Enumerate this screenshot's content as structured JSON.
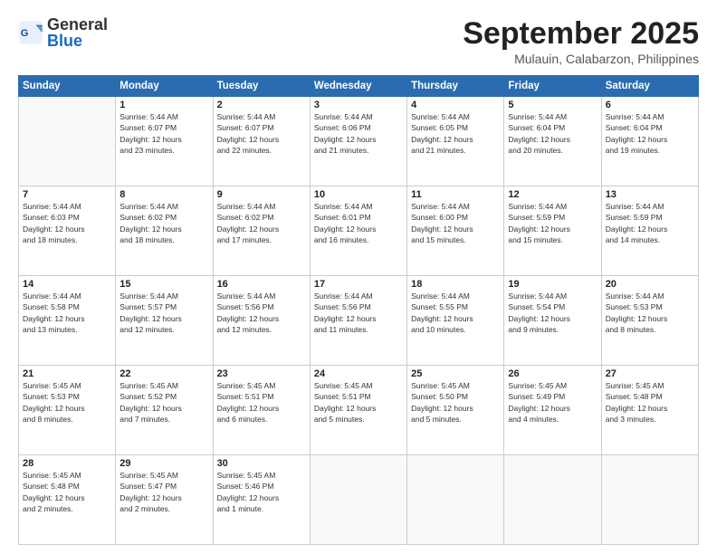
{
  "header": {
    "logo": {
      "general": "General",
      "blue": "Blue"
    },
    "title": "September 2025",
    "location": "Mulauin, Calabarzon, Philippines"
  },
  "weekdays": [
    "Sunday",
    "Monday",
    "Tuesday",
    "Wednesday",
    "Thursday",
    "Friday",
    "Saturday"
  ],
  "days": [
    {
      "num": "",
      "info": ""
    },
    {
      "num": "1",
      "info": "Sunrise: 5:44 AM\nSunset: 6:07 PM\nDaylight: 12 hours\nand 23 minutes."
    },
    {
      "num": "2",
      "info": "Sunrise: 5:44 AM\nSunset: 6:07 PM\nDaylight: 12 hours\nand 22 minutes."
    },
    {
      "num": "3",
      "info": "Sunrise: 5:44 AM\nSunset: 6:06 PM\nDaylight: 12 hours\nand 21 minutes."
    },
    {
      "num": "4",
      "info": "Sunrise: 5:44 AM\nSunset: 6:05 PM\nDaylight: 12 hours\nand 21 minutes."
    },
    {
      "num": "5",
      "info": "Sunrise: 5:44 AM\nSunset: 6:04 PM\nDaylight: 12 hours\nand 20 minutes."
    },
    {
      "num": "6",
      "info": "Sunrise: 5:44 AM\nSunset: 6:04 PM\nDaylight: 12 hours\nand 19 minutes."
    },
    {
      "num": "7",
      "info": "Sunrise: 5:44 AM\nSunset: 6:03 PM\nDaylight: 12 hours\nand 18 minutes."
    },
    {
      "num": "8",
      "info": "Sunrise: 5:44 AM\nSunset: 6:02 PM\nDaylight: 12 hours\nand 18 minutes."
    },
    {
      "num": "9",
      "info": "Sunrise: 5:44 AM\nSunset: 6:02 PM\nDaylight: 12 hours\nand 17 minutes."
    },
    {
      "num": "10",
      "info": "Sunrise: 5:44 AM\nSunset: 6:01 PM\nDaylight: 12 hours\nand 16 minutes."
    },
    {
      "num": "11",
      "info": "Sunrise: 5:44 AM\nSunset: 6:00 PM\nDaylight: 12 hours\nand 15 minutes."
    },
    {
      "num": "12",
      "info": "Sunrise: 5:44 AM\nSunset: 5:59 PM\nDaylight: 12 hours\nand 15 minutes."
    },
    {
      "num": "13",
      "info": "Sunrise: 5:44 AM\nSunset: 5:59 PM\nDaylight: 12 hours\nand 14 minutes."
    },
    {
      "num": "14",
      "info": "Sunrise: 5:44 AM\nSunset: 5:58 PM\nDaylight: 12 hours\nand 13 minutes."
    },
    {
      "num": "15",
      "info": "Sunrise: 5:44 AM\nSunset: 5:57 PM\nDaylight: 12 hours\nand 12 minutes."
    },
    {
      "num": "16",
      "info": "Sunrise: 5:44 AM\nSunset: 5:56 PM\nDaylight: 12 hours\nand 12 minutes."
    },
    {
      "num": "17",
      "info": "Sunrise: 5:44 AM\nSunset: 5:56 PM\nDaylight: 12 hours\nand 11 minutes."
    },
    {
      "num": "18",
      "info": "Sunrise: 5:44 AM\nSunset: 5:55 PM\nDaylight: 12 hours\nand 10 minutes."
    },
    {
      "num": "19",
      "info": "Sunrise: 5:44 AM\nSunset: 5:54 PM\nDaylight: 12 hours\nand 9 minutes."
    },
    {
      "num": "20",
      "info": "Sunrise: 5:44 AM\nSunset: 5:53 PM\nDaylight: 12 hours\nand 8 minutes."
    },
    {
      "num": "21",
      "info": "Sunrise: 5:45 AM\nSunset: 5:53 PM\nDaylight: 12 hours\nand 8 minutes."
    },
    {
      "num": "22",
      "info": "Sunrise: 5:45 AM\nSunset: 5:52 PM\nDaylight: 12 hours\nand 7 minutes."
    },
    {
      "num": "23",
      "info": "Sunrise: 5:45 AM\nSunset: 5:51 PM\nDaylight: 12 hours\nand 6 minutes."
    },
    {
      "num": "24",
      "info": "Sunrise: 5:45 AM\nSunset: 5:51 PM\nDaylight: 12 hours\nand 5 minutes."
    },
    {
      "num": "25",
      "info": "Sunrise: 5:45 AM\nSunset: 5:50 PM\nDaylight: 12 hours\nand 5 minutes."
    },
    {
      "num": "26",
      "info": "Sunrise: 5:45 AM\nSunset: 5:49 PM\nDaylight: 12 hours\nand 4 minutes."
    },
    {
      "num": "27",
      "info": "Sunrise: 5:45 AM\nSunset: 5:48 PM\nDaylight: 12 hours\nand 3 minutes."
    },
    {
      "num": "28",
      "info": "Sunrise: 5:45 AM\nSunset: 5:48 PM\nDaylight: 12 hours\nand 2 minutes."
    },
    {
      "num": "29",
      "info": "Sunrise: 5:45 AM\nSunset: 5:47 PM\nDaylight: 12 hours\nand 2 minutes."
    },
    {
      "num": "30",
      "info": "Sunrise: 5:45 AM\nSunset: 5:46 PM\nDaylight: 12 hours\nand 1 minute."
    },
    {
      "num": "",
      "info": ""
    },
    {
      "num": "",
      "info": ""
    },
    {
      "num": "",
      "info": ""
    },
    {
      "num": "",
      "info": ""
    }
  ]
}
